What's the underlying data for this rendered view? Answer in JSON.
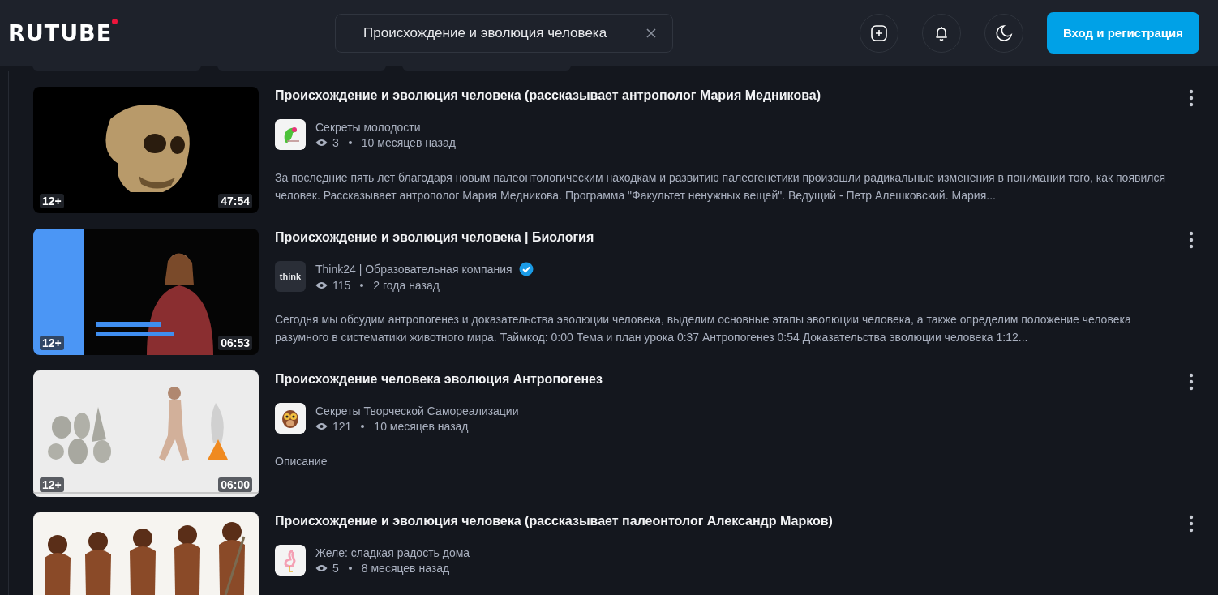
{
  "header": {
    "logo": "RUTUBE",
    "search": {
      "value": "Происхождение и эволюция человека"
    },
    "login_button": "Вход и регистрация"
  },
  "filter_chips": [
    {
      "kind": "chip"
    },
    {
      "kind": "chip"
    },
    {
      "kind": "chip"
    }
  ],
  "videos": [
    {
      "title": "Происхождение и эволюция человека (рассказывает антрополог Мария Медникова)",
      "age_rating": "12+",
      "duration": "47:54",
      "channel": "Секреты молодости",
      "verified": false,
      "views": "3",
      "published": "10 месяцев назад",
      "description": "За последние пять лет благодаря новым палеонтологическим находкам и развитию палеогенетики произошли радикальные изменения в понимании того, как появился человек. Рассказывает антрополог Мария Медникова. Программа \"Факультет ненужных вещей\". Ведущий - Петр Алешковский. Мария..."
    },
    {
      "title": "Происхождение и эволюция человека | Биология",
      "age_rating": "12+",
      "duration": "06:53",
      "channel": "Think24 | Образовательная компания",
      "avatar_text": "think",
      "verified": true,
      "views": "115",
      "published": "2 года назад",
      "description": "Сегодня мы обсудим антропогенез и доказательства эволюции человека, выделим основные этапы эволюции человека, а также определим положение человека разумного в систематики животного мира. Таймкод: 0:00 Тема и план урока 0:37 Антропогенез 0:54 Доказательства эволюции человека 1:12..."
    },
    {
      "title": "Происхождение человека эволюция Антропогенез",
      "age_rating": "12+",
      "duration": "06:00",
      "channel": "Секреты Творческой Самореализации",
      "verified": false,
      "views": "121",
      "published": "10 месяцев назад",
      "description": "Описание"
    },
    {
      "title": "Происхождение и эволюция человека (рассказывает палеонтолог Александр Марков)",
      "channel": "Желе: сладкая радость дома",
      "verified": false,
      "views": "5",
      "published": "8 месяцев назад"
    }
  ]
}
